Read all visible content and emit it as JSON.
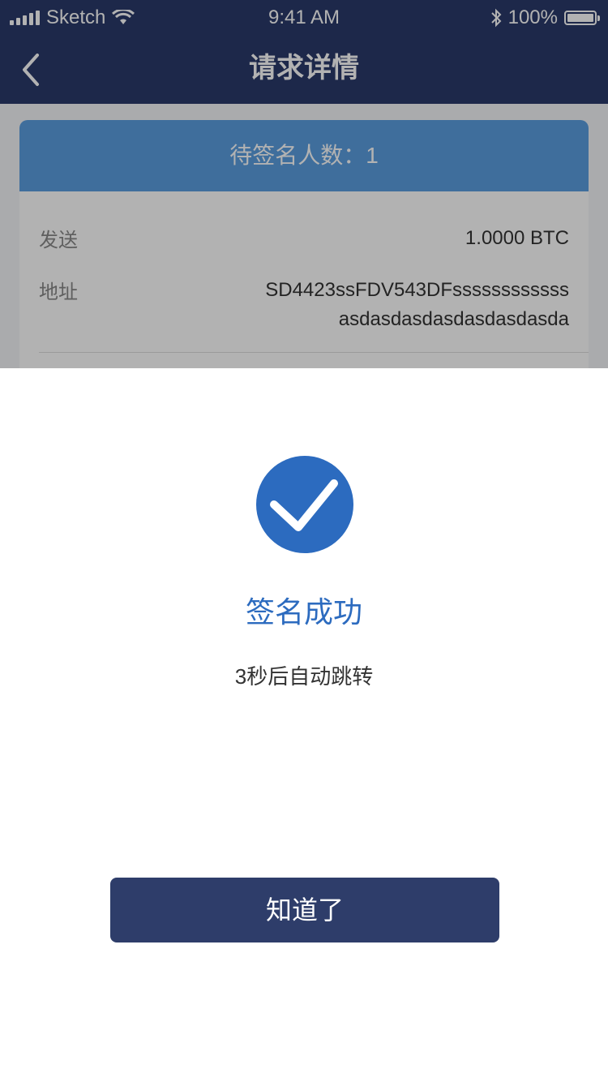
{
  "status_bar": {
    "carrier": "Sketch",
    "time": "9:41 AM",
    "battery_text": "100%",
    "battery_level": 1.0
  },
  "nav": {
    "title": "请求详情",
    "back_icon": "chevron-left-icon"
  },
  "card": {
    "header": "待签名人数：1",
    "send_label": "发送",
    "send_value": "1.0000 BTC",
    "address_label": "地址",
    "address_line1": "SD4423ssFDV543DFssssssssssss",
    "address_line2": "asdasdasdasdasdasdasda"
  },
  "dialog": {
    "icon": "check-circle-icon",
    "title": "签名成功",
    "subtitle": "3秒后自动跳转",
    "button_label": "知道了"
  },
  "colors": {
    "nav_bg": "#2a3a6b",
    "card_header": "#5b9ee0",
    "success_blue": "#2c6bbf",
    "button_bg": "#2e3d6a",
    "overlay": "rgba(0,0,0,0.3)"
  }
}
